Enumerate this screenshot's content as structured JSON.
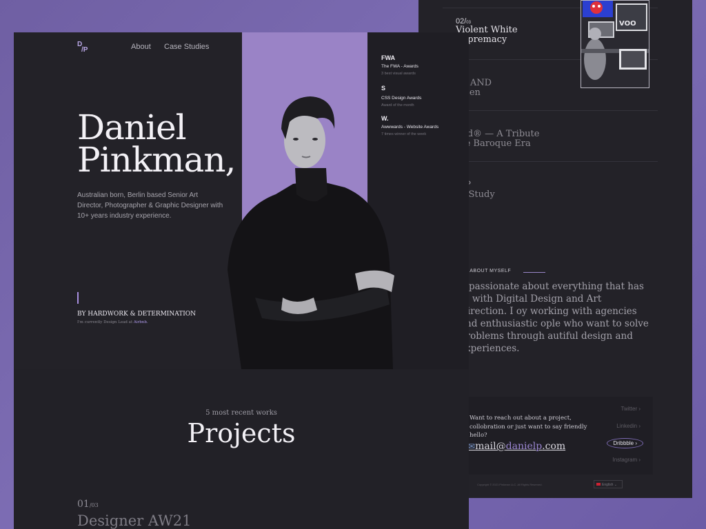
{
  "nav": {
    "logo_top": "D",
    "logo_bottom": "/P",
    "about": "About",
    "case_studies": "Case Studies"
  },
  "hero": {
    "name_line1": "Daniel",
    "name_line2": "Pinkman,",
    "bio": "Australian born, Berlin based Senior Art Director, Photographer & Graphic Designer with 10+ years industry experience.",
    "tagline": "BY HARDWORK & DETERMINATION",
    "sub_prefix": "I'm currently Design Lead at",
    "sub_company": "Airbnb."
  },
  "awards": [
    {
      "icon": "FWA",
      "title": "The FWA - Awards",
      "sub": "3 best visual awards"
    },
    {
      "icon": "S",
      "title": "CSS Design Awards",
      "sub": "Award of the month"
    },
    {
      "icon": "W.",
      "title": "Awwwards - Website Awards",
      "sub": "7 times winner of the week"
    }
  ],
  "projects_section": {
    "subtitle": "5 most recent works",
    "title": "Projects"
  },
  "first_project": {
    "num": "01",
    "total": "/03",
    "title": "Designer AW21"
  },
  "back_projects": [
    {
      "num": "02/",
      "total": "03",
      "line1": "Violent White",
      "line2": "Supremacy"
    },
    {
      "num": "",
      "total": "",
      "line1": "ng AND",
      "line2": "ufsen"
    },
    {
      "num": "",
      "total": "",
      "line1": "hpd® — A Tribute",
      "line2": "the Baroque Era"
    },
    {
      "num": "",
      "total": "",
      "line1": "MP",
      "line2": "se Study"
    }
  ],
  "about": {
    "label": "E ABOUT MYSELF",
    "text": "n passionate about everything that has to with Digital Design and Art Direction. I oy working with agencies and enthusiastic ople who want to solve problems through autiful design and experiences."
  },
  "contact": {
    "question": "Want to reach out about a project, collobration or just want to say friendly hello?",
    "mail_prefix": "mail@",
    "mail_domain": "danielp",
    "mail_suffix": ".com",
    "socials": [
      "Twitter",
      "Linkedin",
      "Dribbble",
      "Instagram"
    ],
    "active_social": "Dribbble",
    "copyright": "Copyright © 2021 Pinkman LLC. All Rights Reserved.",
    "language": "English"
  },
  "colors": {
    "accent": "#9a83c6",
    "panel": "#232228",
    "background": "#7566aa"
  }
}
